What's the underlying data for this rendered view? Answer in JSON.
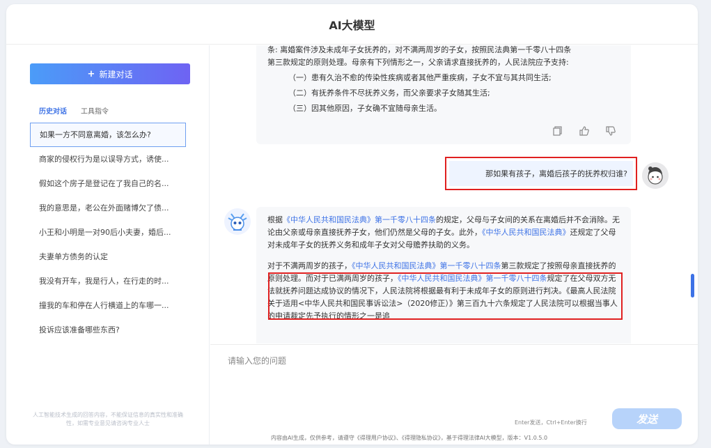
{
  "header": {
    "title": "AI大模型"
  },
  "sidebar": {
    "new_chat_label": "新建对话",
    "tabs": [
      "历史对话",
      "工具指令"
    ],
    "history": [
      "如果一方不同意离婚，该怎么办?",
      "商家的侵权行为是以误导方式，诱使...",
      "假如这个房子是登记在了我自己的名...",
      "我的意思是，老公在外面赌博欠了债...",
      "小王和小明是一对90后小夫妻，婚后...",
      "夫妻单方债务的认定",
      "我没有开车，我是行人，在行走的时...",
      "撞我的车和停在人行横道上的车哪一...",
      "投诉应该准备哪些东西?"
    ],
    "footer": "人工智能技术生成的回答内容，不能保证信息的真实性和准确性，如需专业意见请咨询专业人士"
  },
  "messages": {
    "ai_top": {
      "line1": "条: 离婚案件涉及未成年子女抚养的，对不满两周岁的子女，按照民法典第一千零八十四条",
      "line2": "第三款规定的原则处理。母亲有下列情形之一，父亲请求直接抚养的，人民法院应予支持:",
      "items": [
        "（一）患有久治不愈的传染性疾病或者其他严重疾病，子女不宜与其共同生活;",
        "（二）有抚养条件不尽抚养义务，而父亲要求子女随其生活;",
        "（三）因其他原因，子女确不宜随母亲生活。"
      ]
    },
    "user_question": "那如果有孩子，离婚后孩子的抚养权归谁?",
    "ai_second": {
      "p1_a": "根据",
      "p1_link1": "《中华人民共和国民法典》第一千零八十四条",
      "p1_b": "的规定，父母与子女间的关系在离婚后并不会消除。无论由父亲或母亲直接抚养子女，他们仍然是父母的子女。此外，",
      "p1_link2": "《中华人民共和国民法典》",
      "p1_c": "还规定了父母对未成年子女的抚养义务和成年子女对父母赡养扶助的义务。",
      "p2_a": "对于不满两周岁的孩子，",
      "p2_link1": "《中华人民共和国民法典》第一千零八十四条",
      "p2_b": "第三款规定了按照母亲直接抚养的原则处理。而对于已满两周岁的孩子，",
      "p2_link2": "《中华人民共和国民法典》第一千零八十四条",
      "p2_c": "规定了在父母双方无法就抚养问题达成协议的情况下，人民法院将根据最有利于未成年子女的原则进行判决。《最高人民法院关于适用<中华人民共和国民事诉讼法>（2020修正）》第三百九十六条规定了人民法院可以根据当事人的申请裁定先予执行的情形之一是追"
    }
  },
  "input": {
    "placeholder": "请输入您的问题",
    "hint": "Enter发送，Ctrl+Enter换行",
    "send_label": "发送",
    "disclaimer": "内容由AI生成，仅供参考，请遵守《得理用户协议》、《得理隐私协议》，基于得理法律AI大模型，版本：V1.0.5.0"
  }
}
